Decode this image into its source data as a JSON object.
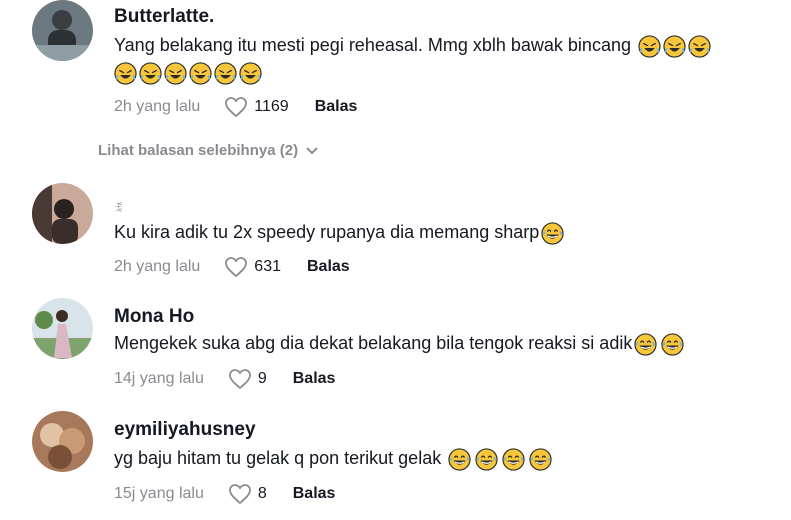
{
  "comments": [
    {
      "username": "Butterlatte.",
      "text_line1": "Yang belakang itu mesti pegi reheasal. Mmg xblh bawak bincang ",
      "emojis_line1": [
        "rofl-emoji",
        "rofl-emoji",
        "rofl-emoji"
      ],
      "emojis_line2": [
        "rofl-emoji",
        "rofl-emoji",
        "rofl-emoji",
        "rofl-emoji",
        "rofl-emoji",
        "rofl-emoji"
      ],
      "time": "2h yang lalu",
      "likes": "1169",
      "reply_label": "Balas"
    },
    {
      "username": "ꉂ",
      "text": "Ku kira adik tu 2x speedy rupanya dia memang sharp",
      "emojis": [
        "grin-sweat-emoji"
      ],
      "time": "2h yang lalu",
      "likes": "631",
      "reply_label": "Balas"
    },
    {
      "username": "Mona Ho",
      "text": "Mengekek suka abg dia dekat belakang bila tengok reaksi si adik",
      "emojis": [
        "grin-sweat-emoji",
        "grin-sweat-emoji"
      ],
      "time": "14j yang lalu",
      "likes": "9",
      "reply_label": "Balas"
    },
    {
      "username": "eymiliyahusney",
      "text": "yg baju hitam tu gelak q pon terikut gelak ",
      "emojis": [
        "grin-sweat-emoji",
        "grin-sweat-emoji",
        "grin-sweat-emoji",
        "grin-sweat-emoji"
      ],
      "time": "15j yang lalu",
      "likes": "8",
      "reply_label": "Balas"
    }
  ],
  "view_more_replies": "Lihat balasan selebihnya (2)",
  "colors": {
    "text": "#161823",
    "secondary": "#8a8b91",
    "emoji": "#f7c63a"
  }
}
